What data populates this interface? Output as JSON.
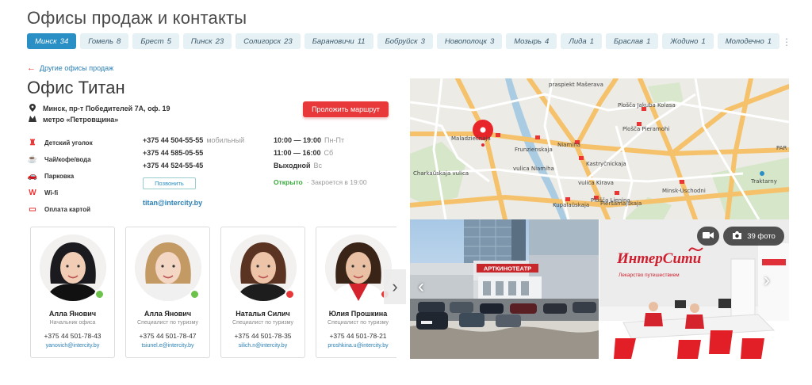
{
  "page": {
    "title": "Офисы продаж и контакты"
  },
  "city_tabs": [
    {
      "name": "Минск",
      "count": "34",
      "active": true
    },
    {
      "name": "Гомель",
      "count": "8"
    },
    {
      "name": "Брест",
      "count": "5"
    },
    {
      "name": "Пинск",
      "count": "23"
    },
    {
      "name": "Солигорск",
      "count": "23"
    },
    {
      "name": "Барановичи",
      "count": "11"
    },
    {
      "name": "Бобруйск",
      "count": "3"
    },
    {
      "name": "Новополоцк",
      "count": "3"
    },
    {
      "name": "Мозырь",
      "count": "4"
    },
    {
      "name": "Лида",
      "count": "1"
    },
    {
      "name": "Браслав",
      "count": "1"
    },
    {
      "name": "Жодино",
      "count": "1"
    },
    {
      "name": "Молодечно",
      "count": "1"
    }
  ],
  "back_link": "Другие офисы продаж",
  "office": {
    "title": "Офис Титан",
    "address": "Минск, пр-т Победителей 7А, оф. 19",
    "metro": "метро «Петровщина»",
    "route_button": "Проложить маршрут",
    "amenities": [
      "Детский уголок",
      "Чай/кофе/вода",
      "Парковка",
      "Wi-fi",
      "Оплата картой"
    ],
    "phones": [
      {
        "number": "+375 44 504-55-55",
        "note": "мобильный"
      },
      {
        "number": "+375 44 585-05-55",
        "note": ""
      },
      {
        "number": "+375 44 524-55-45",
        "note": ""
      }
    ],
    "call_button": "Позвонить",
    "email": "titan@intercity.by",
    "hours": [
      {
        "time": "10:00 — 19:00",
        "days": "Пн-Пт"
      },
      {
        "time": "11:00 — 16:00",
        "days": "Сб"
      },
      {
        "time": "Выходной",
        "days": "Вс"
      }
    ],
    "status": "Открыто",
    "closes": "Закроется в 19:00"
  },
  "staff": [
    {
      "name": "Алла Янович",
      "role": "Начальник офиса",
      "phone": "+375 44 501-78-43",
      "email": "yanovich@intercity.by",
      "presence_color": "#6cc24a"
    },
    {
      "name": "Алла Янович",
      "role": "Специалист по туризму",
      "phone": "+375 44 501-78-47",
      "email": "tsiunel.e@intercity.by",
      "presence_color": "#6cc24a"
    },
    {
      "name": "Наталья Силич",
      "role": "Специалист по туризму",
      "phone": "+375 44 501-78-35",
      "email": "silich.n@intercity.by",
      "presence_color": "#e8383a"
    },
    {
      "name": "Юлия Прошкина",
      "role": "Специалист по туризму",
      "phone": "+375 44 501-78-21",
      "email": "proshkina.u@intercity.by",
      "presence_color": "#e8383a"
    }
  ],
  "map": {
    "labels": [
      {
        "text": "Maladziečnaja"
      },
      {
        "text": "Frunzienskaja"
      },
      {
        "text": "Niamiha"
      },
      {
        "text": "Kastryčnickaja"
      },
      {
        "text": "Plošča Lienina"
      },
      {
        "text": "Kupalaŭskaja"
      },
      {
        "text": "Pieršamajskaja"
      },
      {
        "text": "Plošča Pieramohi"
      },
      {
        "text": "Ploščа Jakuba Kolasa"
      },
      {
        "text": "Traktarny"
      },
      {
        "text": "Minsk-Uschodni"
      },
      {
        "text": "praspiekt Mašerava"
      },
      {
        "text": "vulica Niamiha"
      },
      {
        "text": "vulica Kirava"
      },
      {
        "text": "Charkaŭskaja vulica"
      },
      {
        "text": "PAR"
      }
    ]
  },
  "gallery": {
    "photo_count": "39 фото",
    "sign_text": "АРТКИНОТЕАТР",
    "brand_text": "ИнтерСити",
    "brand_tagline": "Лекарство путешествием"
  },
  "colors": {
    "accent": "#2a8fc4",
    "red": "#e8383a",
    "open": "#38a83a"
  }
}
